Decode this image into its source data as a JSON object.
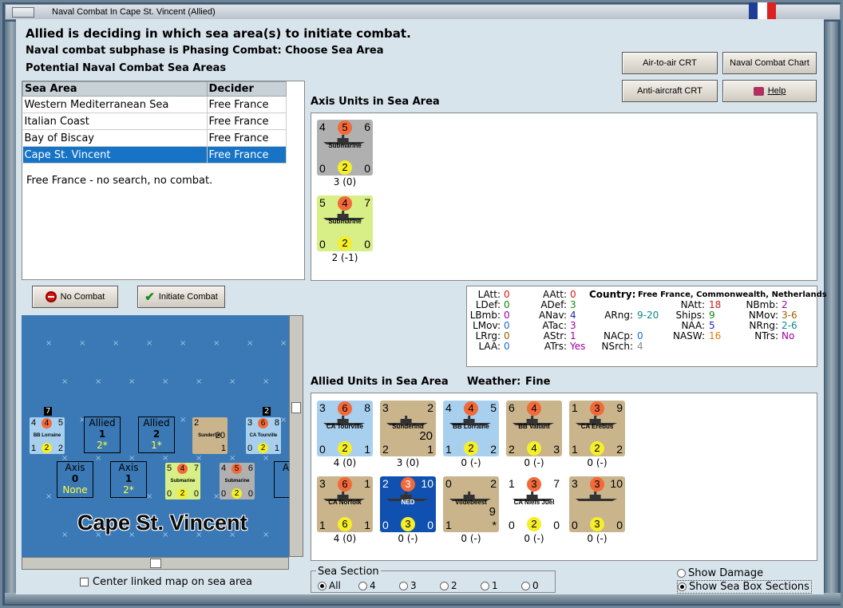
{
  "window": {
    "title": "Naval Combat In Cape St. Vincent (Allied)"
  },
  "header": {
    "line1": "Allied is deciding in which sea area(s) to initiate combat.",
    "line2": "Naval combat subphase is Phasing Combat: Choose Sea Area",
    "line3": "Potential Naval Combat Sea Areas"
  },
  "buttons": {
    "air_to_air": "Air-to-air CRT",
    "naval_chart": "Naval Combat Chart",
    "anti_aircraft": "Anti-aircraft CRT",
    "help": "Help",
    "no_combat": "No Combat",
    "initiate": "Initiate Combat"
  },
  "sea_table": {
    "headers": [
      "Sea Area",
      "Decider"
    ],
    "rows": [
      [
        "Western Mediterranean Sea",
        "Free France"
      ],
      [
        "Italian Coast",
        "Free France"
      ],
      [
        "Bay of Biscay",
        "Free France"
      ],
      [
        "Cape St. Vincent",
        "Free France"
      ]
    ],
    "selected": 3,
    "note": "Free France - no search, no combat."
  },
  "axis": {
    "title": "Axis Units in Sea Area",
    "units": [
      {
        "name": "Submarine",
        "tl": "4",
        "tm": "5",
        "tr": "6",
        "bl": "0",
        "bm": "2",
        "br": "0",
        "below": "3 (0)",
        "color": "#b0b0b0"
      },
      {
        "name": "Submarine",
        "tl": "5",
        "tm": "4",
        "tr": "7",
        "bl": "0",
        "bm": "2",
        "br": "0",
        "below": "2 (-1)",
        "color": "#d8ee86"
      }
    ]
  },
  "stats": {
    "country_label": "Country:",
    "country_value": "Free France, Commonwealth, Netherlands",
    "col1": [
      [
        "LAtt:",
        "0"
      ],
      [
        "LDef:",
        "0"
      ],
      [
        "LBmb:",
        "0"
      ],
      [
        "LMov:",
        "0"
      ],
      [
        "LRrg:",
        "0"
      ],
      [
        "LAA:",
        "0"
      ]
    ],
    "col2": [
      [
        "AAtt:",
        "0"
      ],
      [
        "ADef:",
        "3"
      ],
      [
        "ANav:",
        "4"
      ],
      [
        "ATac:",
        "3"
      ],
      [
        "AStr:",
        "1"
      ],
      [
        "ATrs:",
        "Yes"
      ]
    ],
    "col3": [
      [
        "ARng:",
        "9-20"
      ],
      [
        "NACp:",
        "0"
      ],
      [
        "NSrch:",
        "4"
      ]
    ],
    "col4": [
      [
        "NAtt:",
        "18"
      ],
      [
        "Ships:",
        "9"
      ],
      [
        "NAA:",
        "5"
      ],
      [
        "NASW:",
        "16"
      ]
    ],
    "col5": [
      [
        "NBmb:",
        "2"
      ],
      [
        "NMov:",
        "3-6"
      ],
      [
        "NRng:",
        "2-6"
      ],
      [
        "NTrs:",
        "No"
      ]
    ]
  },
  "allied": {
    "title": "Allied Units in Sea Area",
    "weather_label": "Weather:",
    "weather": "Fine",
    "units": [
      {
        "name": "CA Tourville",
        "tl": "3",
        "tm": "6",
        "tr": "8",
        "bl": "0",
        "bm": "2",
        "br": "1",
        "below": "4 (0)",
        "color": "#a8d0ee"
      },
      {
        "name": "Sunderlnd",
        "tl": "3",
        "tm": "",
        "tr": "2",
        "bl": "2",
        "bm": "",
        "br": "1",
        "mid": "20",
        "below": "3 (0)",
        "color": "#c9b48c"
      },
      {
        "name": "BB Lorraine",
        "tl": "4",
        "tm": "4",
        "tr": "5",
        "bl": "1",
        "bm": "2",
        "br": "2",
        "below": "0 (-)",
        "color": "#a8d0ee"
      },
      {
        "name": "BB Valiant",
        "tl": "6",
        "tm": "4",
        "tr": "",
        "bl": "2",
        "bm": "4",
        "br": "3",
        "below": "0 (-)",
        "color": "#c9b48c"
      },
      {
        "name": "CA Erebus",
        "tl": "1",
        "tm": "3",
        "tr": "9",
        "bl": "1",
        "bm": "2",
        "br": "2",
        "below": "0 (-)",
        "color": "#c9b48c"
      },
      {
        "name": "CA Norfolk",
        "tl": "3",
        "tm": "6",
        "tr": "1",
        "bl": "1",
        "bm": "6",
        "br": "1",
        "below": "4 (0)",
        "color": "#c9b48c"
      },
      {
        "name": "NED",
        "tl": "2",
        "tm": "3",
        "tr": "10",
        "bl": "0",
        "bm": "3",
        "br": "0",
        "below": "0 (-)",
        "color": "#1050b0"
      },
      {
        "name": "Vildebeest",
        "tl": "0",
        "tm": "",
        "tr": "2",
        "bl": "1",
        "bm": "",
        "br": "*",
        "mid": "9",
        "below": "0 (-)",
        "color": "#c9b48c"
      },
      {
        "name": "CA Niels Juel",
        "tl": "1",
        "tm": "3",
        "tr": "7",
        "bl": "0",
        "bm": "2",
        "br": "0",
        "below": "0 (-)",
        "color": "#ffffff"
      },
      {
        "name": "",
        "tl": "3",
        "tm": "3",
        "tr": "10",
        "bl": "0",
        "bm": "3",
        "br": "0",
        "below": "0 (-)",
        "color": "#c9b48c"
      }
    ]
  },
  "map": {
    "title": "Cape St. Vincent",
    "allied1": {
      "label": "Allied",
      "num": "1",
      "val": "2*"
    },
    "allied2": {
      "label": "Allied",
      "num": "2",
      "val": "1*"
    },
    "axis0": {
      "label": "Axis",
      "num": "0",
      "val": "None"
    },
    "axis1": {
      "label": "Axis",
      "num": "1",
      "val": "2*"
    },
    "axis_partial": "A",
    "stack1": "7",
    "stack2": "2",
    "tiles": [
      {
        "name": "BB Lorraine",
        "tl": "4",
        "tm": "4",
        "tr": "5",
        "bl": "1",
        "bm": "2",
        "br": "2"
      },
      {
        "name": "Sunderlnd",
        "mid": "20",
        "tl": "2",
        "br": "1"
      },
      {
        "name": "CA Tourville",
        "tl": "3",
        "tm": "6",
        "tr": "8",
        "bl": "0",
        "bm": "2",
        "br": "1"
      },
      {
        "name": "Submarine",
        "tl": "5",
        "tm": "4",
        "tr": "7",
        "bl": "0",
        "bm": "2",
        "br": "0"
      },
      {
        "name": "Submarine",
        "tl": "4",
        "tm": "5",
        "tr": "6",
        "bl": "0",
        "bm": "2",
        "br": "0"
      }
    ]
  },
  "center_check": "Center linked map on sea area",
  "sea_section": {
    "label": "Sea Section",
    "options": [
      "All",
      "4",
      "3",
      "2",
      "1",
      "0"
    ],
    "selected": "All"
  },
  "options": {
    "show_damage": "Show Damage",
    "show_sections": "Show Sea Box Sections"
  }
}
